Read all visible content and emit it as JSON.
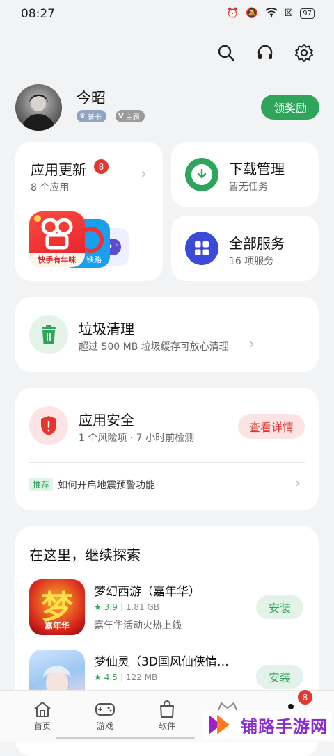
{
  "status": {
    "time": "08:27",
    "battery": "97"
  },
  "profile": {
    "name": "今昭",
    "badge1": "普卡",
    "badge2": "主题",
    "claim_label": "领奖励"
  },
  "updates": {
    "title": "应用更新",
    "badge": "8",
    "subtitle": "8 个应用",
    "app1_label": "快手有年味",
    "app2_label": "铁路"
  },
  "downloads": {
    "title": "下载管理",
    "subtitle": "暂无任务"
  },
  "services": {
    "title": "全部服务",
    "subtitle": "16 项服务"
  },
  "cleanup": {
    "title": "垃圾清理",
    "subtitle": "超过 500 MB 垃圾缓存可放心清理"
  },
  "security": {
    "title": "应用安全",
    "subtitle": "1 个风险项 · 7 小时前检测",
    "button": "查看详情",
    "tip_tag": "推荐",
    "tip_text": "如何开启地震预警功能"
  },
  "explore": {
    "title": "在这里，继续探索",
    "apps": [
      {
        "name": "梦幻西游（嘉年华）",
        "rating": "3.9",
        "size": "1.81 GB",
        "desc": "嘉年华活动火热上线",
        "button": "安装",
        "icon_text": "梦",
        "icon_sub": "嘉年华"
      },
      {
        "name": "梦仙灵（3D国风仙侠情…",
        "rating": "4.5",
        "size": "122 MB",
        "button": "安装"
      }
    ]
  },
  "nav": {
    "items": [
      {
        "label": "首页"
      },
      {
        "label": "游戏"
      },
      {
        "label": "软件"
      }
    ],
    "badge": "8"
  },
  "watermark": "铺路手游网",
  "colors": {
    "accent": "#2ea55a",
    "danger": "#e2362f",
    "service_blue": "#3b4bd8"
  }
}
